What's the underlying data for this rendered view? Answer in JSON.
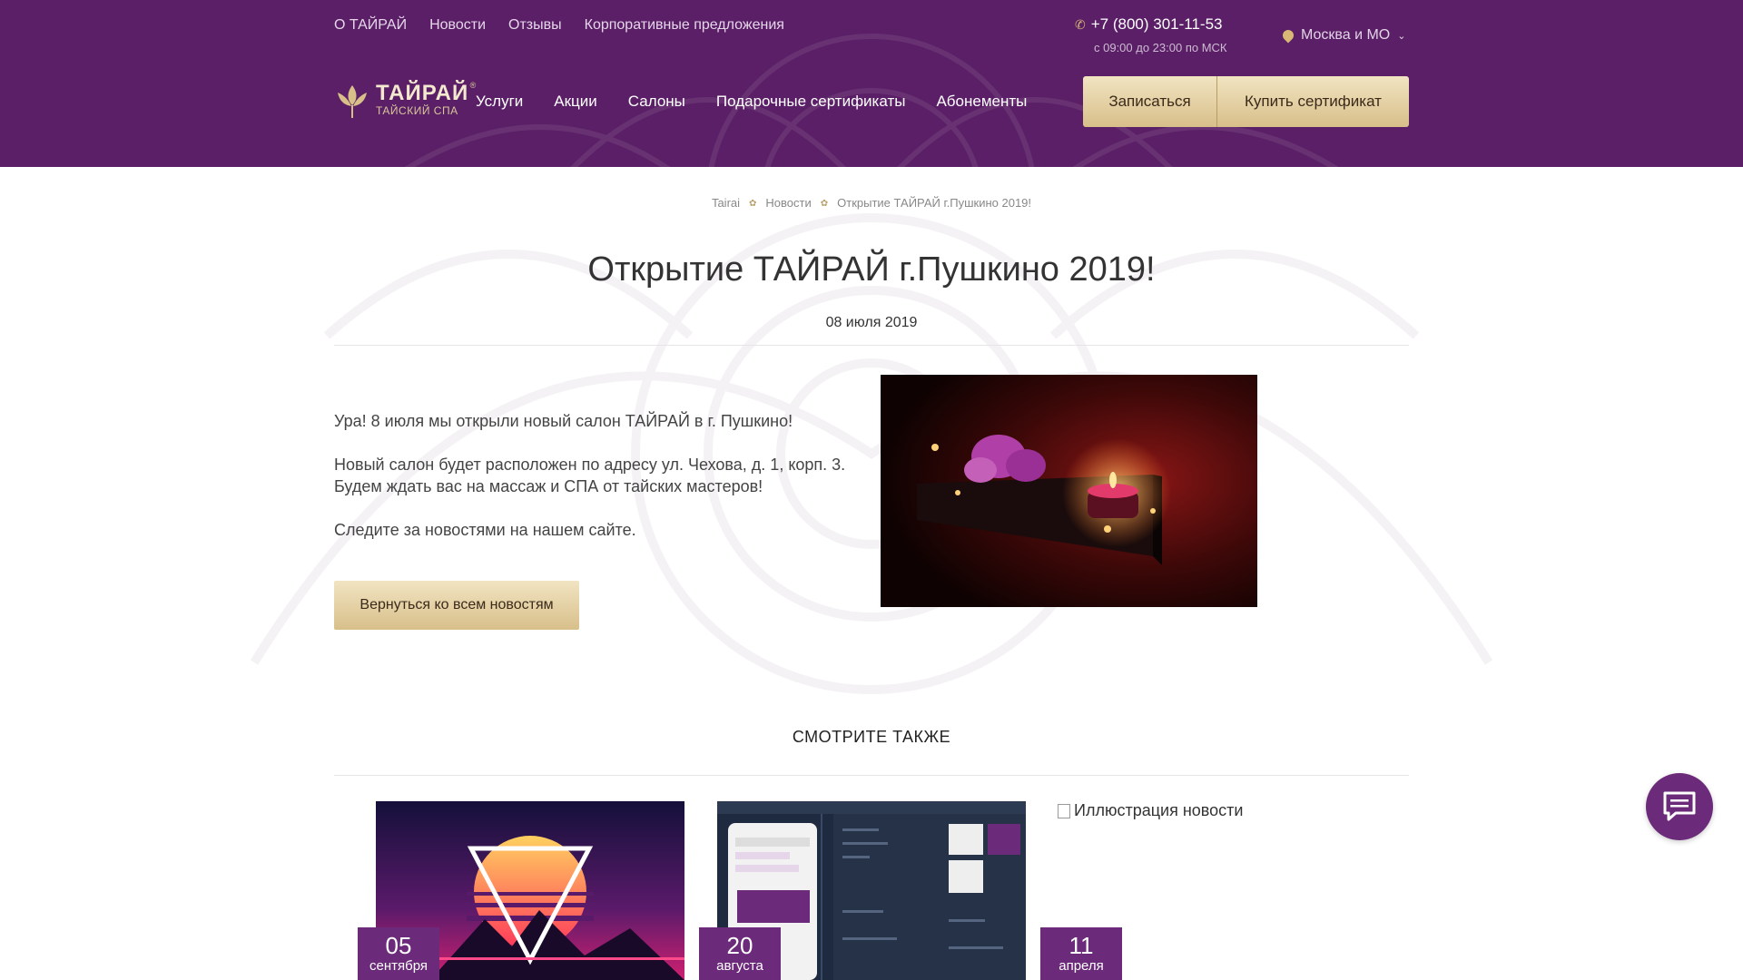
{
  "header": {
    "top_links": [
      "О ТАЙРАЙ",
      "Новости",
      "Отзывы",
      "Корпоративные предложения"
    ],
    "phone": "+7 (800) 301-11-53",
    "hours": "с 09:00 до 23:00 по МСК",
    "region": "Москва и МО",
    "logo": {
      "title": "ТАЙРАЙ",
      "subtitle": "ТАЙСКИЙ СПА",
      "reg": "®"
    },
    "nav": [
      "Услуги",
      "Акции",
      "Салоны",
      "Подарочные сертификаты",
      "Абонементы"
    ],
    "book_button": "Записаться",
    "buy_certificate_button": "Купить сертификат",
    "colors": {
      "header_bg": "#5a1f66",
      "accent_gold": "#d8bf8a",
      "date_badge": "#6b2a7a"
    }
  },
  "breadcrumb": [
    "Tairai",
    "Новости",
    "Открытие ТАЙРАЙ г.Пушкино 2019!"
  ],
  "article": {
    "title": "Открытие ТАЙРАЙ г.Пушкино 2019!",
    "date": "08 июля 2019",
    "paragraphs": [
      "Ура! 8 июля мы открыли новый салон ТАЙРАЙ в г. Пушкино!",
      "Новый салон будет расположен по адресу ул. Чехова, д. 1, корп. 3. Будем ждать вас на массаж и СПА от тайских мастеров!",
      "Следите за новостями на нашем сайте."
    ],
    "back_button": "Вернуться ко всем новостям"
  },
  "see_also": {
    "heading": "СМОТРИТЕ ТАКЖЕ",
    "cards": [
      {
        "day": "05",
        "month": "сентября"
      },
      {
        "day": "20",
        "month": "августа"
      },
      {
        "day": "11",
        "month": "апреля",
        "image_alt": "Иллюстрация новости"
      }
    ]
  },
  "icons": {
    "phone": "phone-icon",
    "location": "location-pin-icon",
    "chevron": "chevron-down-icon",
    "chat": "chat-icon",
    "breadcrumb_separator": "leaf-icon"
  }
}
